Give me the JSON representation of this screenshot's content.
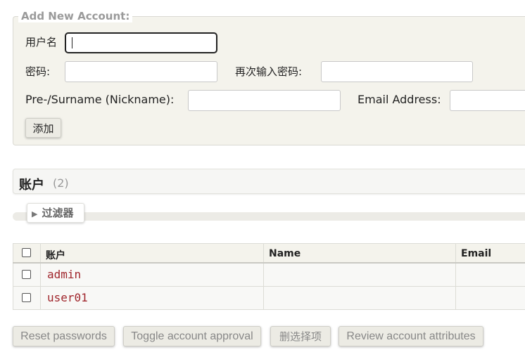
{
  "add_account": {
    "legend": "Add New Account:",
    "username_label": "用户名",
    "username_value": "",
    "password_label": "密码:",
    "password_value": "",
    "password_repeat_label": "再次输入密码:",
    "password_repeat_value": "",
    "fullname_label": "Pre-/Surname (Nickname):",
    "fullname_value": "",
    "email_label": "Email Address:",
    "email_value": "",
    "add_button": "添加"
  },
  "accounts": {
    "title": "账户",
    "count": "(2)",
    "filter_label": "过滤器",
    "columns": [
      "账户",
      "Name",
      "Email"
    ],
    "rows": [
      {
        "account": "admin",
        "name": "",
        "email": ""
      },
      {
        "account": "user01",
        "name": "",
        "email": ""
      }
    ]
  },
  "actions": {
    "reset_passwords": "Reset passwords",
    "toggle_approval": "Toggle account approval",
    "delete_selected": "删选择项",
    "review_attributes": "Review account attributes"
  },
  "colors": {
    "panel_bg": "#f4f3ec",
    "link": "#a0262c",
    "muted_button_text": "#888888"
  }
}
